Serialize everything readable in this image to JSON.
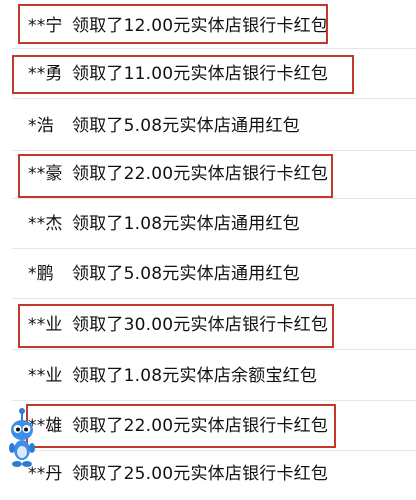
{
  "records": [
    {
      "name": "**宁",
      "message": "领取了12.00元实体店银行卡红包",
      "highlighted": true
    },
    {
      "name": "**勇",
      "message": "领取了11.00元实体店银行卡红包",
      "highlighted": true
    },
    {
      "name": "*浩",
      "message": "领取了5.08元实体店通用红包",
      "highlighted": false
    },
    {
      "name": "**豪",
      "message": "领取了22.00元实体店银行卡红包",
      "highlighted": true
    },
    {
      "name": "**杰",
      "message": "领取了1.08元实体店通用红包",
      "highlighted": false
    },
    {
      "name": "*鹏",
      "message": "领取了5.08元实体店通用红包",
      "highlighted": false
    },
    {
      "name": "**业",
      "message": "领取了30.00元实体店银行卡红包",
      "highlighted": true
    },
    {
      "name": "**业",
      "message": "领取了1.08元实体店余额宝红包",
      "highlighted": false
    },
    {
      "name": "**雄",
      "message": "领取了22.00元实体店银行卡红包",
      "highlighted": true
    },
    {
      "name": "**丹",
      "message": "领取了25.00元实体店银行卡红包",
      "highlighted": false
    }
  ],
  "colors": {
    "highlight_border": "#c0392b",
    "text": "#111111",
    "divider": "#e6e6e6"
  },
  "icons": {
    "mascot": "blue-cartoon-mascot-icon"
  }
}
